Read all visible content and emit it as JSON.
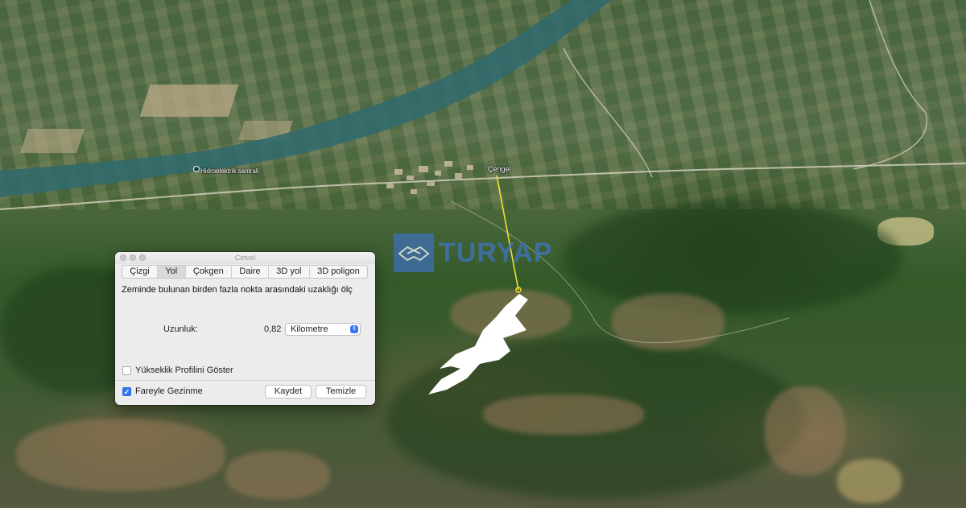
{
  "map": {
    "village_label": "Çengel",
    "poi_label": "Hidroelektrik santrali",
    "watermark_text": "TURYAP",
    "path_color": "#f0e130"
  },
  "dialog": {
    "title": "Cetvel",
    "tabs": [
      {
        "label": "Çizgi",
        "active": false
      },
      {
        "label": "Yol",
        "active": true
      },
      {
        "label": "Çokgen",
        "active": false
      },
      {
        "label": "Daire",
        "active": false
      },
      {
        "label": "3D yol",
        "active": false
      },
      {
        "label": "3D poligon",
        "active": false
      }
    ],
    "description": "Zeminde bulunan birden fazla nokta arasındaki uzaklığı ölç",
    "length_label": "Uzunluk:",
    "length_value": "0,82",
    "unit_selected": "Kilometre",
    "elevation_profile_label": "Yükseklik Profilini Göster",
    "elevation_profile_checked": false,
    "mouse_nav_label": "Fareyle Gezinme",
    "mouse_nav_checked": true,
    "save_label": "Kaydet",
    "clear_label": "Temizle"
  },
  "colors": {
    "accent": "#3478f6",
    "dialog_bg": "#ececec"
  }
}
